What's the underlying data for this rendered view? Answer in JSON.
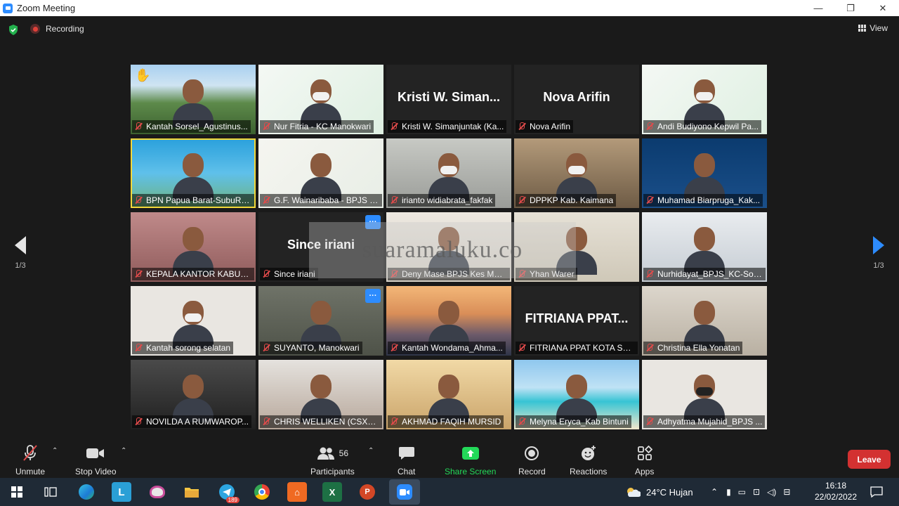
{
  "window": {
    "title": "Zoom Meeting",
    "minimize": "—",
    "maximize": "❐",
    "close": "✕"
  },
  "meeting": {
    "recording_label": "Recording",
    "view_label": "View"
  },
  "colors": {
    "accent": "#2d8cff",
    "active_speaker": "#f2d83a",
    "leave": "#d33131",
    "mic_off": "#e24b4b",
    "share": "#23d959"
  },
  "pagination": {
    "left": "1/3",
    "right": "1/3"
  },
  "watermark": "suaramaluku.co",
  "tiles": [
    {
      "name": "Kantah Sorsel_Agustinus...",
      "bg": "bg-outdoor",
      "hand": "✋"
    },
    {
      "name": "Nur Fitria - KC Manokwari",
      "bg": "bg-bpjs"
    },
    {
      "name": "Kristi  W. Simanjuntak (Ka...",
      "display_name": "Kristi  W. Siman..."
    },
    {
      "name": "Nova Arifin",
      "display_name": "Nova Arifin"
    },
    {
      "name": "Andi Budiyono Kepwil Pa...",
      "bg": "bg-bpjs"
    },
    {
      "name": "BPN Papua Barat-SubuR Kab...",
      "bg": "bg-gtra",
      "active": true
    },
    {
      "name": "G.F. Wainaribaba - BPJS K...",
      "bg": "bg-papabar"
    },
    {
      "name": "irianto widiabrata_fakfak",
      "bg": "bg-room"
    },
    {
      "name": "DPPKP Kab. Kaimana",
      "bg": "bg-room2"
    },
    {
      "name": "Muhamad Biarpruga_Kak...",
      "bg": "bg-atr"
    },
    {
      "name": "KEPALA KANTOR KABUPA...",
      "bg": "bg-pink"
    },
    {
      "name": "Since iriani",
      "display_name": "Since iriani",
      "more": "···"
    },
    {
      "name": "Deny Mase BPJS Kes Manok...",
      "bg": "bg-deny"
    },
    {
      "name": "Yhan Warer",
      "bg": "bg-yhan"
    },
    {
      "name": "Nurhidayat_BPJS_KC-Sor...",
      "bg": "bg-office"
    },
    {
      "name": "Kantah sorong selatan",
      "bg": "bg-white"
    },
    {
      "name": "SUYANTO,  Manokwari",
      "bg": "bg-room3",
      "more": "···"
    },
    {
      "name": "Kantah Wondama_Ahma...",
      "bg": "bg-sunset"
    },
    {
      "name": "FITRIANA PPAT KOTA SOR...",
      "display_name": "FITRIANA  PPAT..."
    },
    {
      "name": "Christina Ella Yonatan",
      "bg": "bg-shelf"
    },
    {
      "name": "NOVILDA A RUMWAROP...",
      "bg": "bg-dark"
    },
    {
      "name": "CHRIS WELLIKEN (CSXV) ...",
      "bg": "bg-podium"
    },
    {
      "name": "AKHMAD FAQIH MURSID",
      "bg": "bg-beige"
    },
    {
      "name": "Melyna Eryca_Kab Bintuni",
      "bg": "bg-beach"
    },
    {
      "name": "Adhyatma Mujahid_BPJS ...",
      "bg": "bg-white"
    }
  ],
  "toolbar": {
    "unmute": "Unmute",
    "stop_video": "Stop Video",
    "participants": "Participants",
    "participants_count": "56",
    "chat": "Chat",
    "share_screen": "Share Screen",
    "record": "Record",
    "reactions": "Reactions",
    "apps": "Apps",
    "leave": "Leave"
  },
  "taskbar": {
    "telegram_badge": "189",
    "weather": "24°C  Hujan",
    "time": "16:18",
    "date": "22/02/2022"
  }
}
